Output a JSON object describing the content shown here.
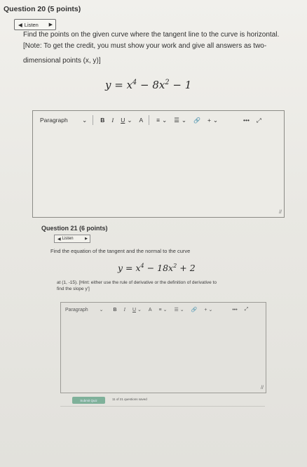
{
  "q20": {
    "title": "Question 20 (5 points)",
    "listen": "Listen",
    "text1": "Find the points on the given curve where the tangent line to the curve is horizontal.",
    "text2": "[Note: To get the credit, you must show your work and give all answers as two-",
    "text3": "dimensional points (x, y)]",
    "equation": {
      "lhs": "y = x",
      "exp1": "4",
      "mid": " − 8x",
      "exp2": "2",
      "rhs": " − 1"
    }
  },
  "editor": {
    "paragraph": "Paragraph",
    "bold": "B",
    "italic": "I",
    "underline": "U",
    "font_color": "A",
    "align": "≡",
    "list": "☰",
    "link": "🔗",
    "add": "+",
    "more": "•••",
    "expand": "⤢",
    "chevron": "⌄",
    "resize": "//"
  },
  "q21": {
    "title": "Question 21 (6 points)",
    "listen": "Listen",
    "text1": "Find the equation of the tangent and the normal to the curve",
    "equation": {
      "lhs": "y = x",
      "exp1": "4",
      "mid": " − 18x",
      "exp2": "2",
      "rhs": " + 2"
    },
    "text2": "at (1, -15). [Hint: either use the rule of derivative or the definition of derivative to",
    "text3": "find the slope y']"
  },
  "footer": {
    "submit": "Submit Quiz",
    "status": "11 of 21 questions saved"
  }
}
